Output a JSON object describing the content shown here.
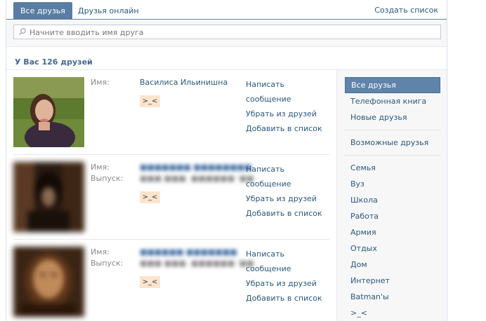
{
  "tabs": {
    "all_friends": "Все друзья",
    "online": "Друзья онлайн",
    "create_list": "Создать список"
  },
  "search": {
    "placeholder": "Начните вводить имя друга",
    "icon": "search-icon"
  },
  "summary": {
    "count_label": "У Вас 126 друзей"
  },
  "friends": [
    {
      "name_label": "Имя:",
      "name": "Василиса Ильинишна",
      "badge": ">_<",
      "actions": [
        "Написать сообщение",
        "Убрать из друзей",
        "Добавить в список"
      ]
    },
    {
      "name_label": "Имя:",
      "grad_label": "Выпуск:",
      "badge": ">_<",
      "actions": [
        "Написать сообщение",
        "Убрать из друзей",
        "Добавить в список"
      ]
    },
    {
      "name_label": "Имя:",
      "grad_label": "Выпуск:",
      "badge": ">_<",
      "actions": [
        "Написать сообщение",
        "Убрать из друзей",
        "Добавить в список"
      ]
    }
  ],
  "sidebar": {
    "items": [
      "Все друзья",
      "Телефонная книга",
      "Новые друзья",
      "Возможные друзья",
      "Семья",
      "Вуз",
      "Школа",
      "Работа",
      "Армия",
      "Отдых",
      "Дом",
      "Интернет",
      "Batman'ы",
      ">_<"
    ]
  },
  "colors": {
    "accent": "#597da3",
    "link": "#2b587a",
    "badge_bg": "#fde4cf"
  }
}
